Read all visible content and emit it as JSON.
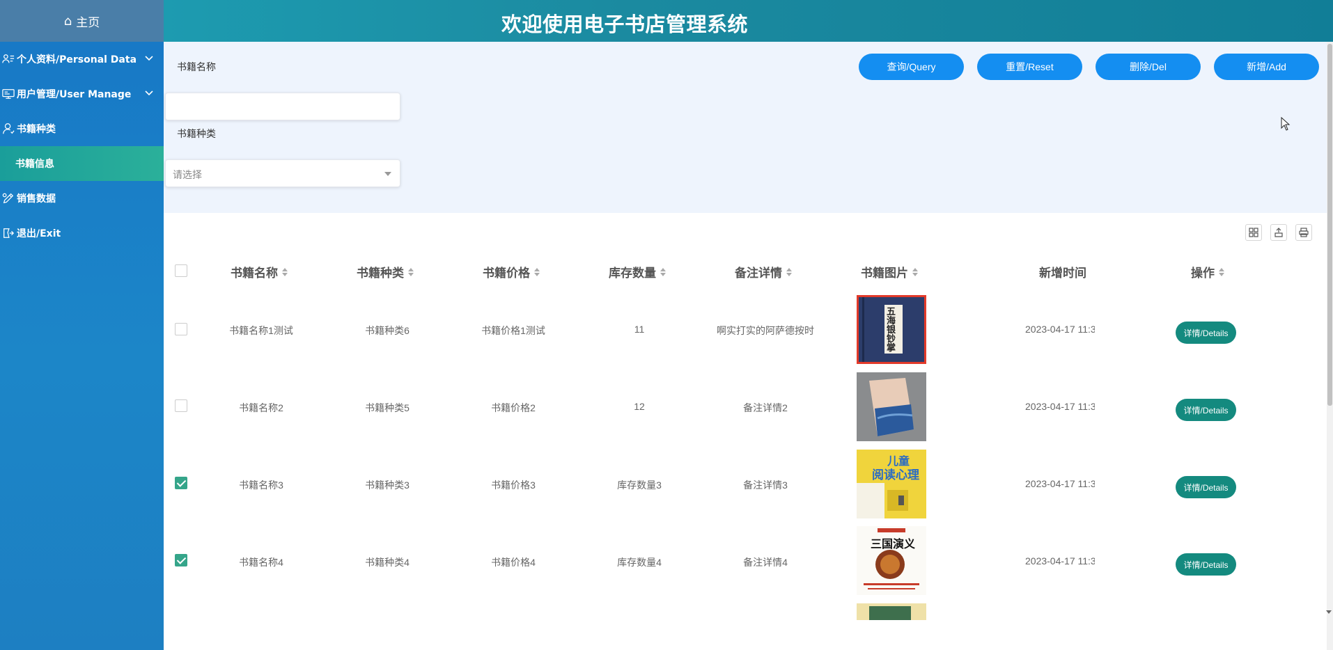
{
  "sidebar": {
    "home_label": "主页",
    "items": [
      {
        "label": "个人资料/Personal Data",
        "icon": "user-info-icon",
        "expandable": true
      },
      {
        "label": "用户管理/User Manage",
        "icon": "monitor-users-icon",
        "expandable": true
      },
      {
        "label": "书籍种类",
        "icon": "user-icon",
        "expandable": false
      },
      {
        "label": "书籍信息",
        "icon": "",
        "expandable": false,
        "active": true
      },
      {
        "label": "销售数据",
        "icon": "edit-icon",
        "expandable": false
      },
      {
        "label": "退出/Exit",
        "icon": "logout-icon",
        "expandable": false
      }
    ]
  },
  "header": {
    "title": "欢迎使用电子书店管理系统"
  },
  "search": {
    "name_label": "书籍名称",
    "name_value": "",
    "type_label": "书籍种类",
    "type_placeholder": "请选择",
    "buttons": {
      "query": "查询/Query",
      "reset": "重置/Reset",
      "delete": "删除/Del",
      "add": "新增/Add"
    }
  },
  "table": {
    "headers": [
      "书籍名称",
      "书籍种类",
      "书籍价格",
      "库存数量",
      "备注详情",
      "书籍图片",
      "新增时间",
      "操作"
    ],
    "rows": [
      {
        "checked": false,
        "name": "书籍名称1测试",
        "type": "书籍种类6",
        "price": "书籍价格1测试",
        "stock": "11",
        "remark": "啊实打实的阿萨德按时",
        "time": "2023-04-17 11:3",
        "action": "详情/Details"
      },
      {
        "checked": false,
        "name": "书籍名称2",
        "type": "书籍种类5",
        "price": "书籍价格2",
        "stock": "12",
        "remark": "备注详情2",
        "time": "2023-04-17 11:3",
        "action": "详情/Details"
      },
      {
        "checked": true,
        "name": "书籍名称3",
        "type": "书籍种类3",
        "price": "书籍价格3",
        "stock": "库存数量3",
        "remark": "备注详情3",
        "time": "2023-04-17 11:3",
        "action": "详情/Details"
      },
      {
        "checked": true,
        "name": "书籍名称4",
        "type": "书籍种类4",
        "price": "书籍价格4",
        "stock": "库存数量4",
        "remark": "备注详情4",
        "time": "2023-04-17 11:3",
        "action": "详情/Details"
      }
    ],
    "cover_texts": {
      "book1": "五海银钞掌",
      "book3_line1": "儿童",
      "book3_line2": "阅读心理",
      "book4": "三国演义"
    }
  },
  "colors": {
    "sidebar": "#1a7fc4",
    "header": "#1b8aa0",
    "primary_button": "#148ef1",
    "detail_button": "#148a7f",
    "active_nav": "#2aa99a",
    "checkbox_checked": "#35a58a"
  }
}
